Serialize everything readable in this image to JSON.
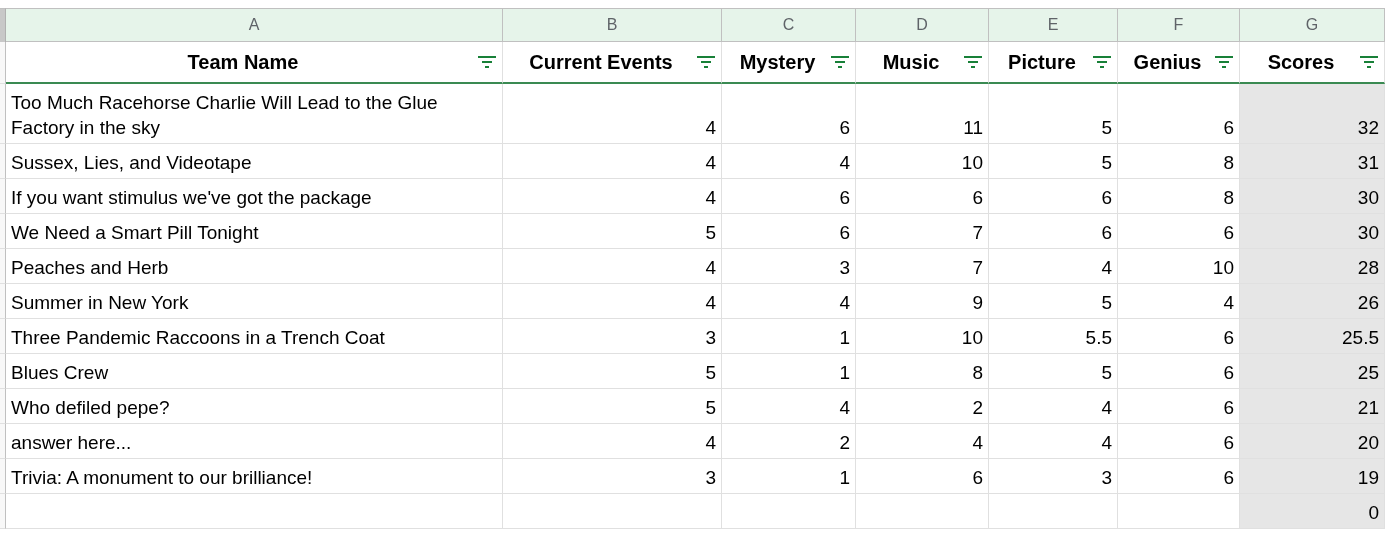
{
  "column_letters": [
    "A",
    "B",
    "C",
    "D",
    "E",
    "F",
    "G"
  ],
  "headers": [
    "Team Name",
    "Current Events",
    "Mystery",
    "Music",
    "Picture",
    "Genius",
    "Scores"
  ],
  "rows": [
    {
      "team": "Too Much Racehorse Charlie Will Lead to the Glue Factory in the sky",
      "values": [
        "4",
        "6",
        "11",
        "5",
        "6"
      ],
      "score": "32"
    },
    {
      "team": "Sussex, Lies, and Videotape",
      "values": [
        "4",
        "4",
        "10",
        "5",
        "8"
      ],
      "score": "31"
    },
    {
      "team": "If you want stimulus we've got the package",
      "values": [
        "4",
        "6",
        "6",
        "6",
        "8"
      ],
      "score": "30"
    },
    {
      "team": "We Need a Smart Pill Tonight",
      "values": [
        "5",
        "6",
        "7",
        "6",
        "6"
      ],
      "score": "30"
    },
    {
      "team": "Peaches and Herb",
      "values": [
        "4",
        "3",
        "7",
        "4",
        "10"
      ],
      "score": "28"
    },
    {
      "team": "Summer in New York",
      "values": [
        "4",
        "4",
        "9",
        "5",
        "4"
      ],
      "score": "26"
    },
    {
      "team": "Three Pandemic Raccoons in a Trench Coat",
      "values": [
        "3",
        "1",
        "10",
        "5.5",
        "6"
      ],
      "score": "25.5"
    },
    {
      "team": "Blues Crew",
      "values": [
        "5",
        "1",
        "8",
        "5",
        "6"
      ],
      "score": "25"
    },
    {
      "team": "Who defiled pepe?",
      "values": [
        "5",
        "4",
        "2",
        "4",
        "6"
      ],
      "score": "21"
    },
    {
      "team": "answer here...",
      "values": [
        "4",
        "2",
        "4",
        "4",
        "6"
      ],
      "score": "20"
    },
    {
      "team": "Trivia: A monument to our brilliance!",
      "values": [
        "3",
        "1",
        "6",
        "3",
        "6"
      ],
      "score": "19"
    },
    {
      "score": "0"
    }
  ]
}
